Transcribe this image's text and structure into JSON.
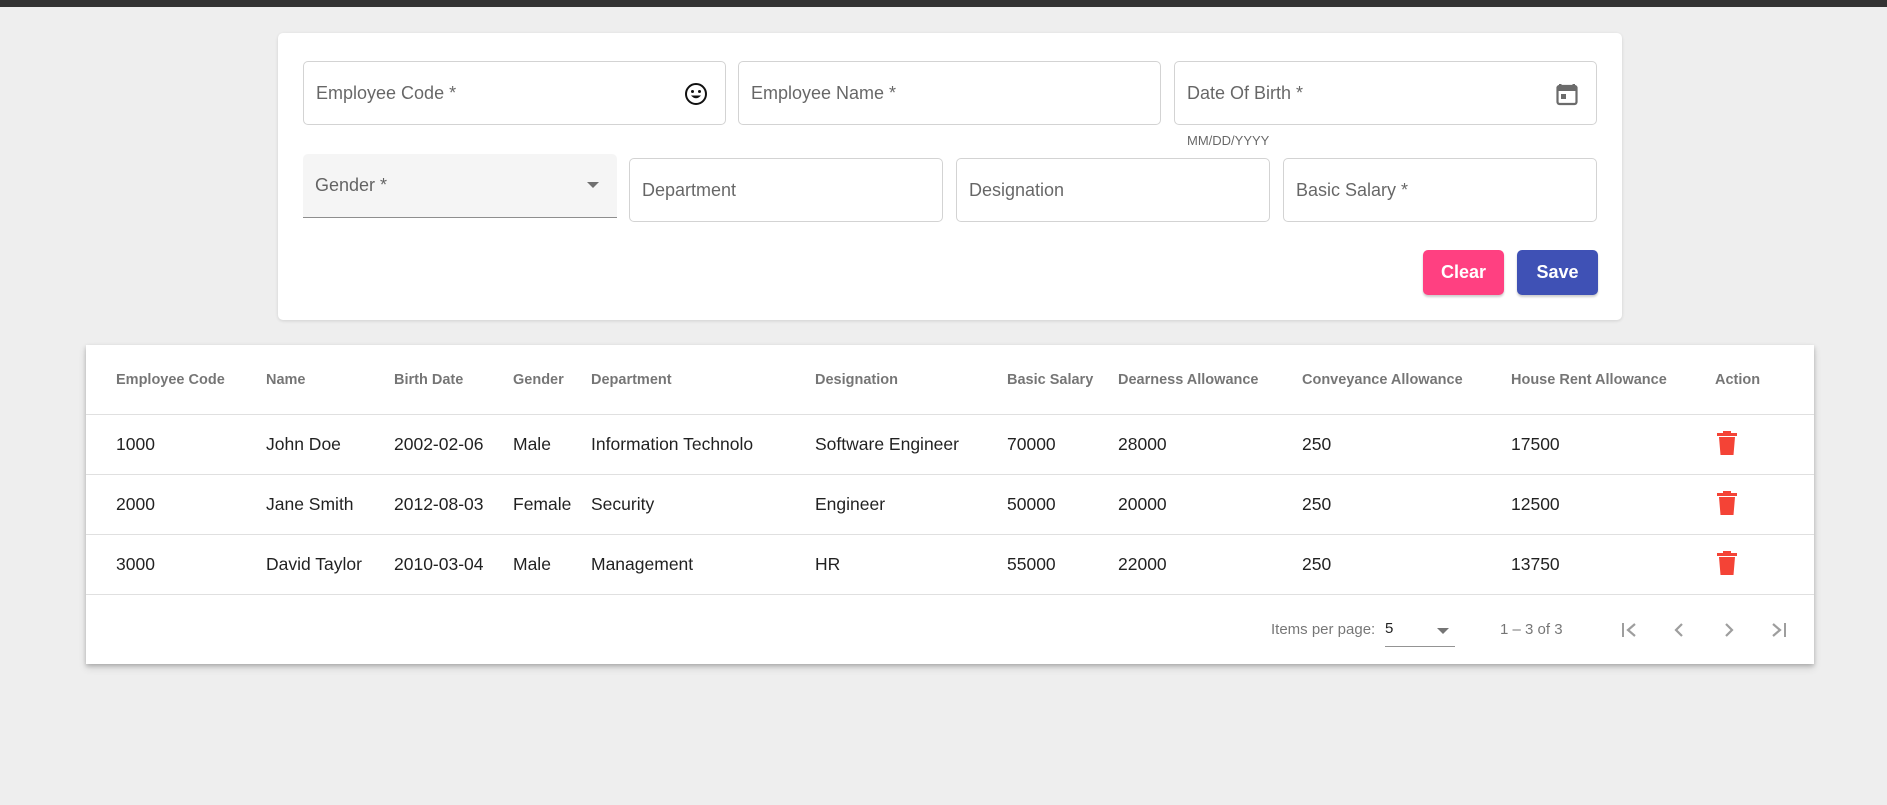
{
  "form": {
    "employee_code_label": "Employee Code *",
    "employee_name_label": "Employee Name *",
    "dob_label": "Date Of Birth *",
    "dob_hint": "MM/DD/YYYY",
    "gender_label": "Gender *",
    "department_label": "Department",
    "designation_label": "Designation",
    "basic_salary_label": "Basic Salary *",
    "clear_label": "Clear",
    "save_label": "Save"
  },
  "colors": {
    "clear_button": "#ff4081",
    "save_button": "#3f51b5",
    "delete_icon": "#f44336",
    "top_bar": "#333333"
  },
  "icons": {
    "employee_code_suffix": "smiley-icon",
    "dob_suffix": "calendar-icon",
    "row_action": "delete-icon",
    "first_page": "first-page-icon",
    "prev_page": "chevron-left-icon",
    "next_page": "chevron-right-icon",
    "last_page": "last-page-icon"
  },
  "table": {
    "headers": {
      "code": "Employee Code",
      "name": "Name",
      "birth": "Birth Date",
      "gender": "Gender",
      "department": "Department",
      "designation": "Designation",
      "salary": "Basic Salary",
      "da": "Dearness Allowance",
      "ca": "Conveyance Allowance",
      "hra": "House Rent Allowance",
      "action": "Action"
    },
    "rows": [
      {
        "code": "1000",
        "name": "John Doe",
        "birth": "2002-02-06",
        "gender": "Male",
        "department": "Information Technolo",
        "designation": "Software Engineer",
        "salary": "70000",
        "da": "28000",
        "ca": "250",
        "hra": "17500"
      },
      {
        "code": "2000",
        "name": "Jane Smith",
        "birth": "2012-08-03",
        "gender": "Female",
        "department": "Security",
        "designation": "Engineer",
        "salary": "50000",
        "da": "20000",
        "ca": "250",
        "hra": "12500"
      },
      {
        "code": "3000",
        "name": "David Taylor",
        "birth": "2010-03-04",
        "gender": "Male",
        "department": "Management",
        "designation": "HR",
        "salary": "55000",
        "da": "22000",
        "ca": "250",
        "hra": "13750"
      }
    ]
  },
  "paginator": {
    "items_per_page_label": "Items per page:",
    "page_size": "5",
    "range_label": "1 – 3 of 3"
  }
}
